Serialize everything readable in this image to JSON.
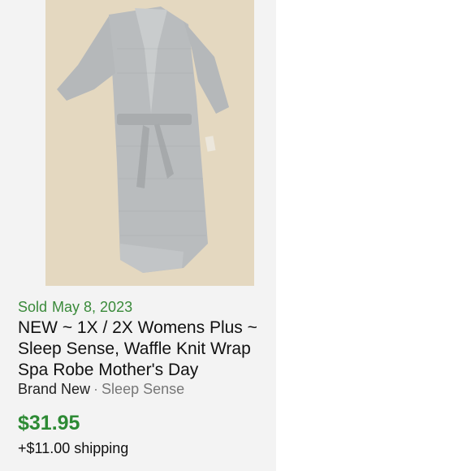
{
  "listing": {
    "status": "Sold",
    "sold_date": "May 8, 2023",
    "title": "NEW ~ 1X / 2X Womens Plus ~ Sleep Sense, Waffle Knit Wrap Spa Robe Mother's Day",
    "condition": "Brand New",
    "separator": "·",
    "brand": "Sleep Sense",
    "price": "$31.95",
    "shipping": "+$11.00 shipping"
  },
  "colors": {
    "sold_green": "#3a8a3a",
    "price_green": "#2d8a34",
    "card_background": "#f3f3f3"
  }
}
